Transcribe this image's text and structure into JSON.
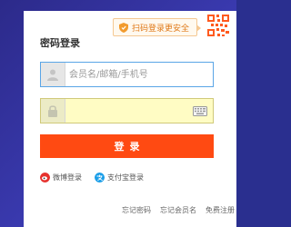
{
  "login": {
    "title": "密码登录",
    "scan_tip": "扫码登录更安全",
    "username_placeholder": "会员名/邮箱/手机号",
    "password_value": "",
    "submit_label": "登录"
  },
  "social": {
    "weibo_label": "微博登录",
    "alipay_label": "支付宝登录"
  },
  "footer_links": {
    "forgot_password": "忘记密码",
    "forgot_username": "忘记会员名",
    "register": "免费注册"
  },
  "colors": {
    "accent": "#ff4a12",
    "background": "#2c2a8a",
    "scan_tip": "#e07a1a"
  },
  "icons": [
    "shield-icon",
    "qr-code-icon",
    "user-icon",
    "lock-icon",
    "keyboard-icon",
    "weibo-icon",
    "alipay-icon"
  ]
}
